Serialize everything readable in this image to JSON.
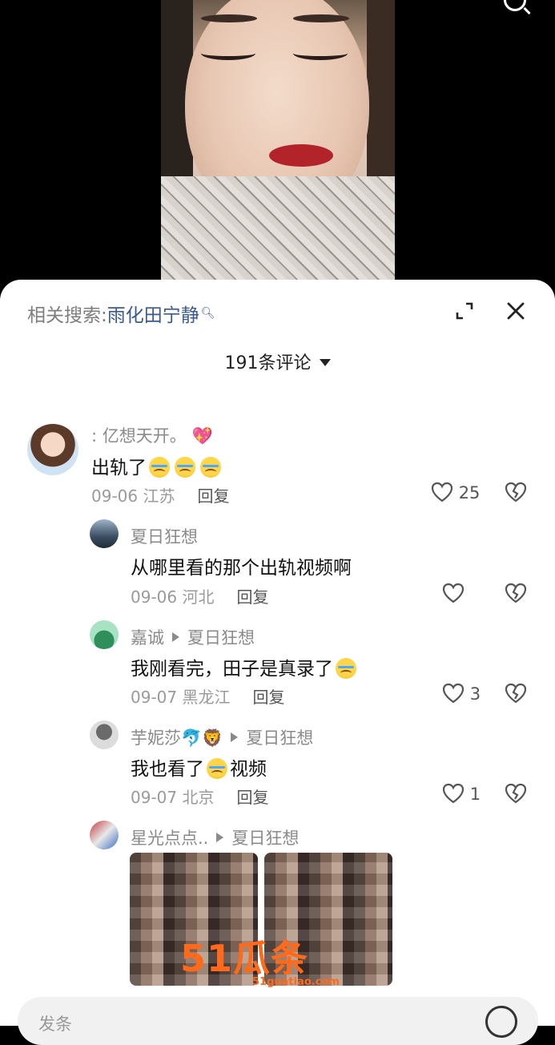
{
  "related_search": {
    "label": "相关搜索:",
    "keyword": "雨化田宁静"
  },
  "comments_header": {
    "count_label": "191条评论"
  },
  "comments": [
    {
      "author": ": 亿想天开。",
      "text": "出轨了",
      "date": "09-06",
      "location": "江苏",
      "reply_label": "回复",
      "likes": "25"
    }
  ],
  "replies": [
    {
      "author": "夏日狂想",
      "reply_to": "",
      "text": "从哪里看的那个出轨视频啊",
      "date": "09-06",
      "location": "河北",
      "reply_label": "回复",
      "likes": ""
    },
    {
      "author": "嘉诚",
      "reply_to": "夏日狂想",
      "text": "我刚看完，田子是真录了",
      "date": "09-07",
      "location": "黑龙江",
      "reply_label": "回复",
      "likes": "3"
    },
    {
      "author": "芋妮莎",
      "reply_to": "夏日狂想",
      "text_before": "我也看了",
      "text_after": "视频",
      "date": "09-07",
      "location": "北京",
      "reply_label": "回复",
      "likes": "1"
    },
    {
      "author": "星光点点..",
      "reply_to": "夏日狂想"
    }
  ],
  "watermark": {
    "brand": "51瓜条",
    "url": "51guatiao.com"
  },
  "input": {
    "placeholder": "发条"
  },
  "colors": {
    "link": "#3a5a90",
    "watermark": "#ff6a1a"
  }
}
